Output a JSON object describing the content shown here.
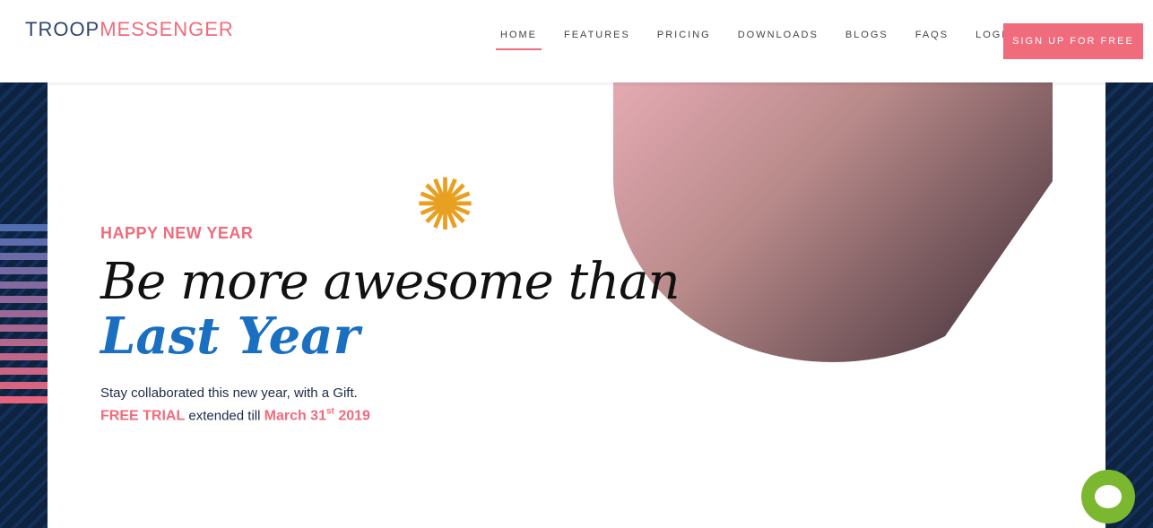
{
  "logo": {
    "part1": "TROOP",
    "part2": "MESSENGER"
  },
  "nav": [
    {
      "label": "HOME",
      "active": true
    },
    {
      "label": "FEATURES"
    },
    {
      "label": "PRICING"
    },
    {
      "label": "DOWNLOADS"
    },
    {
      "label": "BLOGS"
    },
    {
      "label": "FAQS"
    },
    {
      "label": "LOGIN"
    }
  ],
  "signup_label": "SIGN UP FOR FREE",
  "hero": {
    "kicker": "HAPPY NEW YEAR",
    "line1": "Be more awesome than",
    "line2": "Last Year",
    "text": "Stay collaborated this new year, with a Gift.",
    "trial": "FREE TRIAL",
    "extended": " extended till ",
    "date": "March 31",
    "sup": "st",
    "year": " 2019"
  },
  "colors": {
    "accent": "#f06b7b",
    "blue": "#1a6fc0",
    "navy": "#0d2340",
    "chat": "#7cb82f"
  }
}
